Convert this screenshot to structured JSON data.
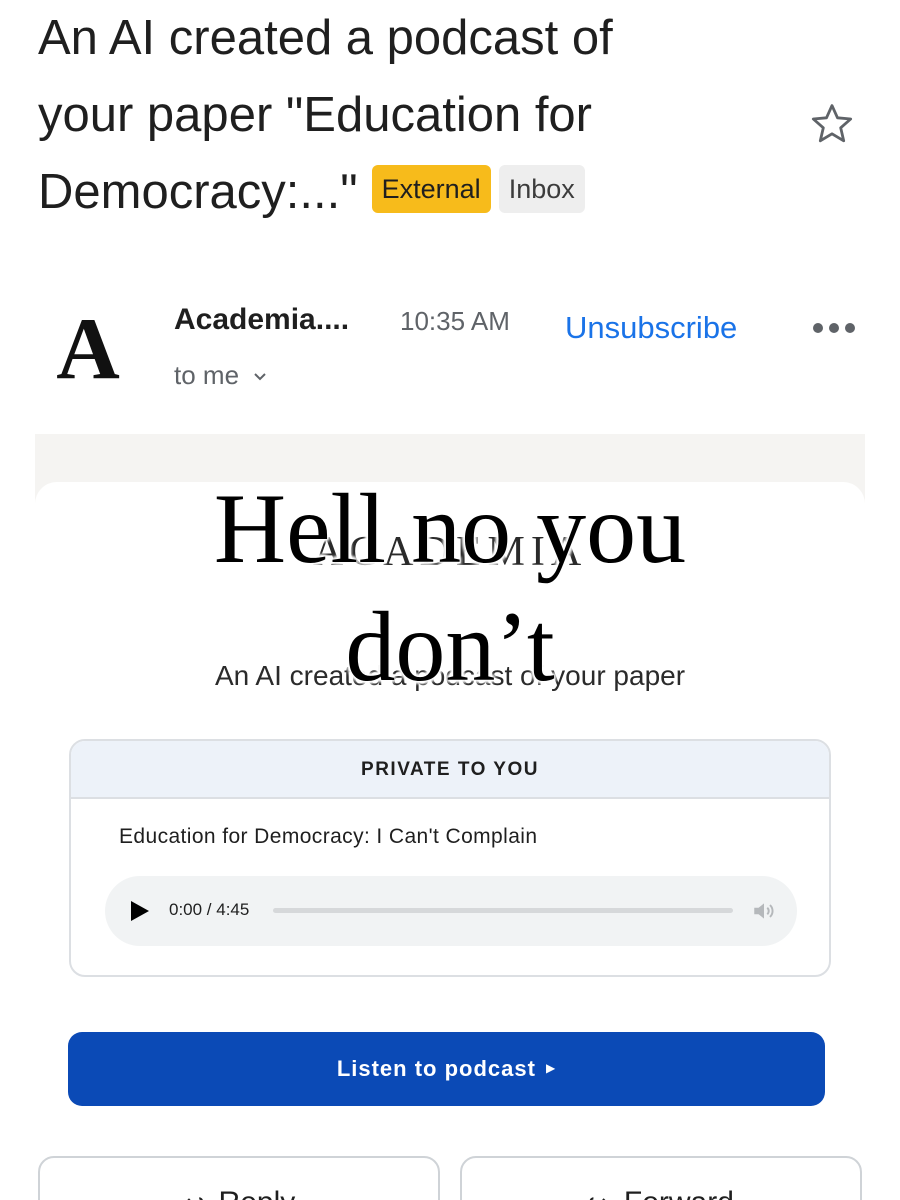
{
  "subject": {
    "line1": "An AI created a podcast of",
    "line2": "your paper \"Education for",
    "line3": "Democracy:...\""
  },
  "labels": {
    "external": "External",
    "inbox": "Inbox"
  },
  "sender": {
    "avatar_letter": "A",
    "name": "Academia....",
    "time": "10:35 AM",
    "unsubscribe": "Unsubscribe",
    "recipient": "to me"
  },
  "email_body": {
    "brand": "ACADEMIA",
    "intro": "An AI created a podcast of your paper",
    "private_header": "PRIVATE TO YOU",
    "paper_title": "Education for Democracy: I Can't Complain",
    "player": {
      "time": "0:00 / 4:45",
      "progress": 0
    },
    "cta_label": "Listen to podcast",
    "reply_label": "Reply",
    "forward_label": "Forward"
  },
  "overlay": {
    "line1": "Hell no you",
    "line2": "don’t"
  },
  "colors": {
    "external_chip": "#f7bb1b",
    "link_blue": "#1a73e8",
    "cta_blue": "#0b4ab6"
  }
}
